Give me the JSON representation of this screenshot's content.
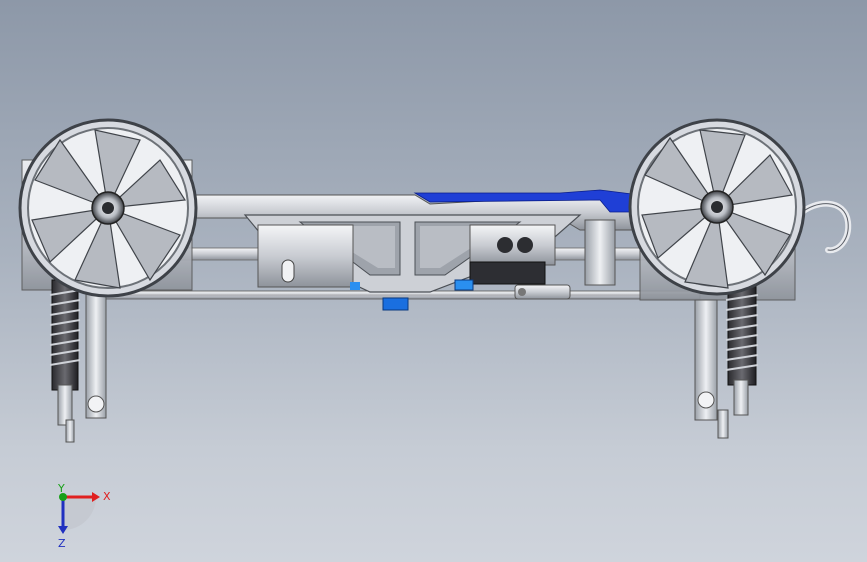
{
  "view": {
    "background_top": "#8d98a8",
    "background_bottom": "#cfd4dc",
    "accent_blue": "#1f3fd6"
  },
  "triad": {
    "x_label": "X",
    "y_label": "Y",
    "z_label": "Z",
    "x_color": "#e02020",
    "y_color": "#18a018",
    "z_color": "#2030c0"
  }
}
